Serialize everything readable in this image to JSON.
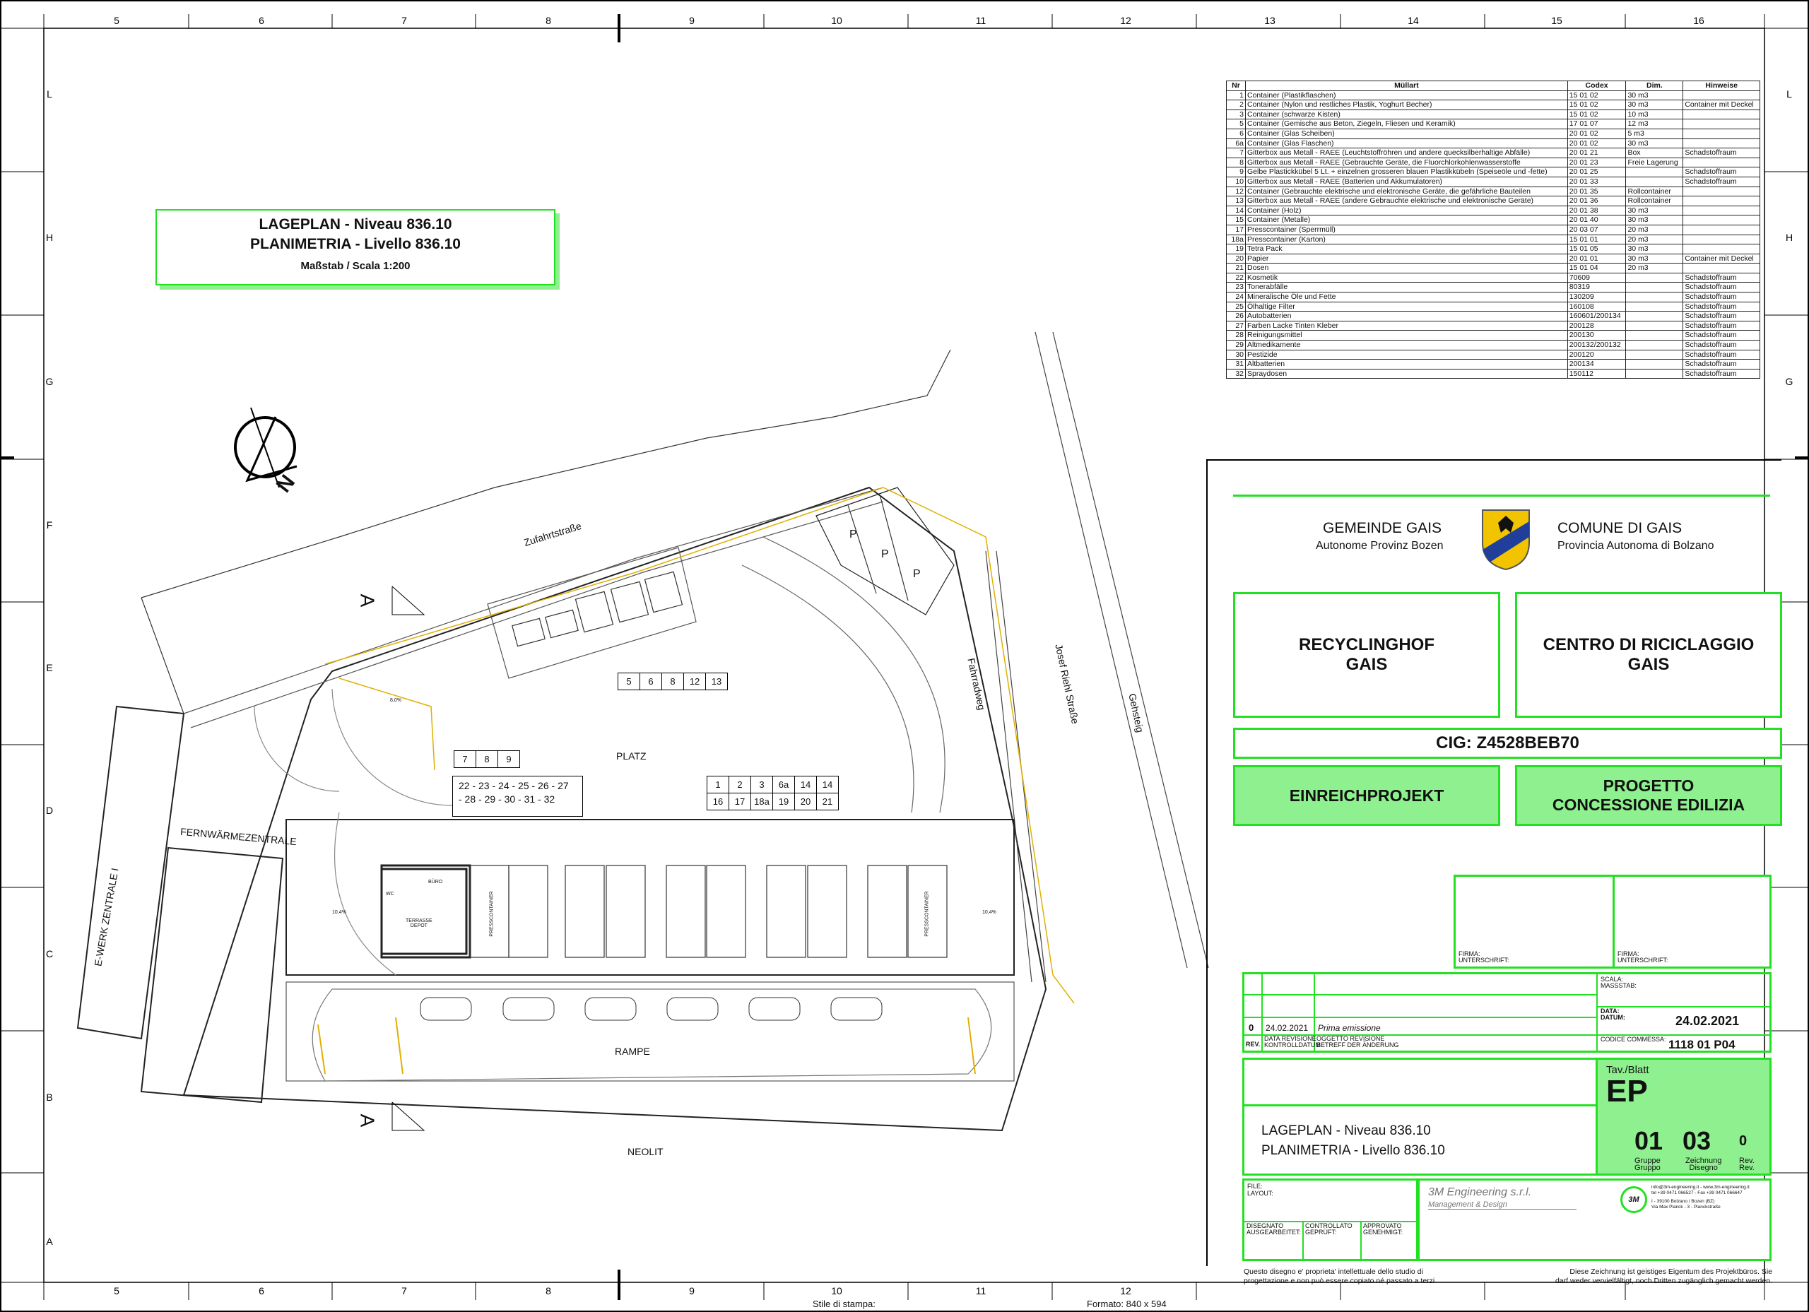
{
  "frame": {
    "cols_top": [
      "5",
      "6",
      "7",
      "8",
      "9",
      "10",
      "11",
      "12",
      "13",
      "14",
      "15",
      "16"
    ],
    "cols_bottom": [
      "5",
      "6",
      "7",
      "8",
      "9",
      "10",
      "11",
      "12"
    ],
    "rows_left": [
      "L",
      "H",
      "G",
      "F",
      "E",
      "D",
      "C",
      "B",
      "A"
    ],
    "rows_right": [
      "L",
      "H",
      "G"
    ]
  },
  "title_block_plan": {
    "line1": "LAGEPLAN - Niveau 836.10",
    "line2": "PLANIMETRIA - Livello 836.10",
    "line3": "Maßstab / Scala  1:200"
  },
  "plan_labels": {
    "zufahrt": "Zufahrtstraße",
    "fahrradweg": "Fahrradweg",
    "josef": "Josef Riehl Straße",
    "gehsteig": "Gehsteig",
    "fernwaerme": "FERNWÄRMEZENTRALE",
    "ewerk": "E-WERK ZENTRALE I",
    "platz": "PLATZ",
    "rampe": "RAMPE",
    "neolit": "NEOLIT",
    "section_a": "A",
    "north": "N",
    "parking": "P",
    "presscontainer": "PRESSCONTAINER",
    "terrasse": "TERRASSE\nDEPOT",
    "buro": "BÜRO",
    "wc": "WC",
    "slope": "10,4%",
    "slope2": "8,0%",
    "numbers_a": [
      "5",
      "6",
      "8",
      "12",
      "13"
    ],
    "numbers_b": [
      "7",
      "8",
      "9"
    ],
    "numbers_c_top": [
      "1",
      "2",
      "3",
      "6a",
      "14",
      "14"
    ],
    "numbers_c_bottom": [
      "16",
      "17",
      "18a",
      "19",
      "20",
      "21"
    ],
    "numbers_d1": "22 - 23 - 24 - 25 - 26 - 27",
    "numbers_d2": "- 28 - 29 - 30 - 31 - 32"
  },
  "waste_table": {
    "headers": [
      "Nr",
      "Müllart",
      "Codex",
      "Dim.",
      "Hinweise"
    ],
    "rows": [
      [
        "1",
        "Container (Plastikflaschen)",
        "15 01 02",
        "30 m3",
        ""
      ],
      [
        "2",
        "Container (Nylon und restliches Plastik, Yoghurt Becher)",
        "15 01 02",
        "30 m3",
        "Container mit Deckel"
      ],
      [
        "3",
        "Container (schwarze Kisten)",
        "15 01 02",
        "10 m3",
        ""
      ],
      [
        "5",
        "Container (Gemische aus Beton, Ziegeln, Fliesen und Keramik)",
        "17 01 07",
        "12 m3",
        ""
      ],
      [
        "6",
        "Container (Glas Scheiben)",
        "20 01 02",
        "5 m3",
        ""
      ],
      [
        "6a",
        "Container (Glas Flaschen)",
        "20 01 02",
        "30 m3",
        ""
      ],
      [
        "7",
        "Gitterbox aus Metall - RAEE (Leuchtstoffröhren und andere quecksilberhaltige Abfälle)",
        "20 01 21",
        "Box",
        "Schadstoffraum"
      ],
      [
        "8",
        "Gitterbox aus Metall - RAEE (Gebrauchte Geräte, die Fluorchlorkohlenwasserstoffe",
        "20 01 23",
        "Freie Lagerung",
        ""
      ],
      [
        "9",
        "Gelbe Plastickkübel 5 Lt. + einzelnen grosseren blauen Plastikkübeln (Speiseöle und -fette)",
        "20 01 25",
        "",
        "Schadstoffraum"
      ],
      [
        "10",
        "Gitterbox aus Metall - RAEE (Batterien und Akkumulatoren)",
        "20 01 33",
        "",
        "Schadstoffraum"
      ],
      [
        "12",
        "Container (Gebrauchte elektrische und elektronische Geräte, die gefährliche Bauteilen",
        "20 01 35",
        "Rollcontainer",
        ""
      ],
      [
        "13",
        "Gitterbox aus Metall - RAEE (andere Gebrauchte elektrische und elektronische Geräte)",
        "20 01 36",
        "Rollcontainer",
        ""
      ],
      [
        "14",
        "Container (Holz)",
        "20 01 38",
        "30 m3",
        ""
      ],
      [
        "15",
        "Container (Metalle)",
        "20 01 40",
        "30 m3",
        ""
      ],
      [
        "17",
        "Presscontainer (Sperrmüll)",
        "20 03 07",
        "20 m3",
        ""
      ],
      [
        "18a",
        "Presscontainer (Karton)",
        "15 01 01",
        "20 m3",
        ""
      ],
      [
        "19",
        "Tetra Pack",
        "15 01 05",
        "30 m3",
        ""
      ],
      [
        "20",
        "Papier",
        "20 01 01",
        "30 m3",
        "Container mit Deckel"
      ],
      [
        "21",
        "Dosen",
        "15 01 04",
        "20 m3",
        ""
      ],
      [
        "22",
        "Kosmetik",
        "70609",
        "",
        "Schadstoffraum"
      ],
      [
        "23",
        "Tonerabfälle",
        "80319",
        "",
        "Schadstoffraum"
      ],
      [
        "24",
        "Mineralische Öle und Fette",
        "130209",
        "",
        "Schadstoffraum"
      ],
      [
        "25",
        "Ölhaltige Filter",
        "160108",
        "",
        "Schadstoffraum"
      ],
      [
        "26",
        "Autobatterien",
        "160601/200134",
        "",
        "Schadstoffraum"
      ],
      [
        "27",
        "Farben Lacke Tinten Kleber",
        "200128",
        "",
        "Schadstoffraum"
      ],
      [
        "28",
        "Reinigungsmittel",
        "200130",
        "",
        "Schadstoffraum"
      ],
      [
        "29",
        "Altmedikamente",
        "200132/200132",
        "",
        "Schadstoffraum"
      ],
      [
        "30",
        "Pestizide",
        "200120",
        "",
        "Schadstoffraum"
      ],
      [
        "31",
        "Altbatterien",
        "200134",
        "",
        "Schadstoffraum"
      ],
      [
        "32",
        "Spraydosen",
        "150112",
        "",
        "Schadstoffraum"
      ]
    ]
  },
  "header_block": {
    "de_name": "GEMEINDE GAIS",
    "de_sub": "Autonome Provinz Bozen",
    "it_name": "COMUNE DI GAIS",
    "it_sub": "Provincia Autonoma di Bolzano",
    "project_de_1": "RECYCLINGHOF",
    "project_de_2": "GAIS",
    "project_it_1": "CENTRO DI RICICLAGGIO",
    "project_it_2": "GAIS",
    "cig": "CIG: Z4528BEB70",
    "phase_de": "EINREICHPROJEKT",
    "phase_it_1": "PROGETTO",
    "phase_it_2": "CONCESSIONE EDILIZIA",
    "colors": {
      "green": "#22e022",
      "green_fill": "#8ef08e",
      "coat_yellow": "#f2c400",
      "coat_blue": "#1f3f9a"
    }
  },
  "signature": {
    "firma1": "FIRMA:",
    "unterschrift1": "UNTERSCHRIFT:",
    "firma2": "FIRMA:",
    "unterschrift2": "UNTERSCHRIFT:"
  },
  "revision": {
    "rev": "0",
    "date": "24.02.2021",
    "desc": "Prima emissione",
    "rev_label": "REV.",
    "data_label_1": "DATA REVISIONE",
    "data_label_2": "KONTROLLDATUM",
    "ogg_label_1": "OGGETTO REVISIONE",
    "ogg_label_2": "BETREFF DER ÄNDERUNG",
    "scala_1": "SCALA:",
    "scala_2": "MASSSTAB:",
    "data_1": "DATA:",
    "data_2": "DATUM:",
    "datum_value": "24.02.2021",
    "codice_label": "CODICE COMMESSA:",
    "codice_value": "1118 01 P04"
  },
  "drawing_block": {
    "title_de": "LAGEPLAN - Niveau 836.10",
    "title_it": "PLANIMETRIA - Livello 836.10",
    "tav": "Tav./Blatt",
    "ep": "EP",
    "gruppe": "01",
    "zeichnung": "03",
    "rev": "0",
    "gruppe_label_1": "Gruppe",
    "gruppe_label_2": "Gruppo",
    "zeich_label_1": "Zeichnung",
    "zeich_label_2": "Disegno",
    "rev_label_1": "Rev.",
    "rev_label_2": "Rev."
  },
  "footer_block": {
    "file": "FILE:",
    "layout": "LAYOUT:",
    "company": "3M Engineering s.r.l.",
    "company_sub": "Management & Design",
    "logo": "3M",
    "contact1": "info@3m-engineering.it - www.3m-engineering.it",
    "contact2": "tel +39 0471 066527 - Fax +39 0471 066647",
    "address1": "I - 39100 Bolzano / Bozen (BZ)",
    "address2": "Via Max Planck - 3 - Planckstraße",
    "disegnato_1": "DISEGNATO",
    "disegnato_2": "AUSGEARBEITET:",
    "controllato_1": "CONTROLLATO",
    "controllato_2": "GEPRÜFT:",
    "approvato_1": "APPROVATO",
    "approvato_2": "GENEHMIGT:",
    "note_it_1": "Questo disegno e' proprieta' intellettuale dello studio di",
    "note_it_2": "progettazione e non può essere copiato né passato a terzi",
    "note_de_1": "Diese Zeichnung ist geistiges Eigentum des Projektbüros. Sie",
    "note_de_2": "darf weder vervielfältigt, noch Dritten zugänglich gemacht werden."
  },
  "print_info": {
    "stile": "Stile di stampa:",
    "formato": "Formato: 840 x 594"
  }
}
